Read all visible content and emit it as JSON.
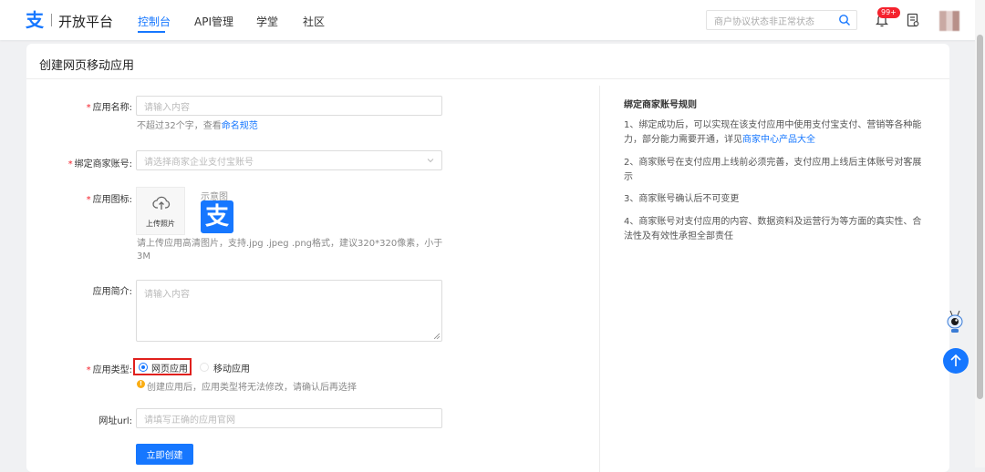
{
  "header": {
    "logo_glyph": "支",
    "brand": "开放平台",
    "nav": [
      "控制台",
      "API管理",
      "学堂",
      "社区"
    ],
    "active_nav": "控制台",
    "search_placeholder": "商户协议状态非正常状态",
    "notification_badge": "99+",
    "accent_color": "#1677ff"
  },
  "page": {
    "title": "创建网页移动应用"
  },
  "form": {
    "app_name": {
      "label": "应用名称:",
      "placeholder": "请输入内容",
      "hint_prefix": "不超过32个字，查看",
      "hint_link": "命名规范"
    },
    "merchant": {
      "label": "绑定商家账号:",
      "placeholder": "请选择商家企业支付宝账号"
    },
    "icon": {
      "label": "应用图标:",
      "upload_text": "上传照片",
      "example_label": "示意图",
      "example_glyph": "支",
      "hint": "请上传应用高清图片，支持.jpg .jpeg .png格式，建议320*320像素，小于3M"
    },
    "intro": {
      "label": "应用简介:",
      "placeholder": "请输入内容"
    },
    "app_type": {
      "label": "应用类型:",
      "options": [
        "网页应用",
        "移动应用"
      ],
      "selected": "网页应用",
      "warning": "创建应用后，应用类型将无法修改，请确认后再选择"
    },
    "url": {
      "label": "网址url:",
      "placeholder": "请填写正确的应用官网"
    },
    "submit_label": "立即创建"
  },
  "rules": {
    "title": "绑定商家账号规则",
    "items": [
      {
        "text": "1、绑定成功后，可以实现在该支付应用中使用支付宝支付、营销等各种能力，部分能力需要开通，详见",
        "link": "商家中心产品大全"
      },
      {
        "text": "2、商家账号在支付应用上线前必须完善，支付应用上线后主体账号对客展示",
        "link": ""
      },
      {
        "text": "3、商家账号确认后不可变更",
        "link": ""
      },
      {
        "text": "4、商家账号对支付应用的内容、数据资料及运营行为等方面的真实性、合法性及有效性承担全部责任",
        "link": ""
      }
    ]
  }
}
